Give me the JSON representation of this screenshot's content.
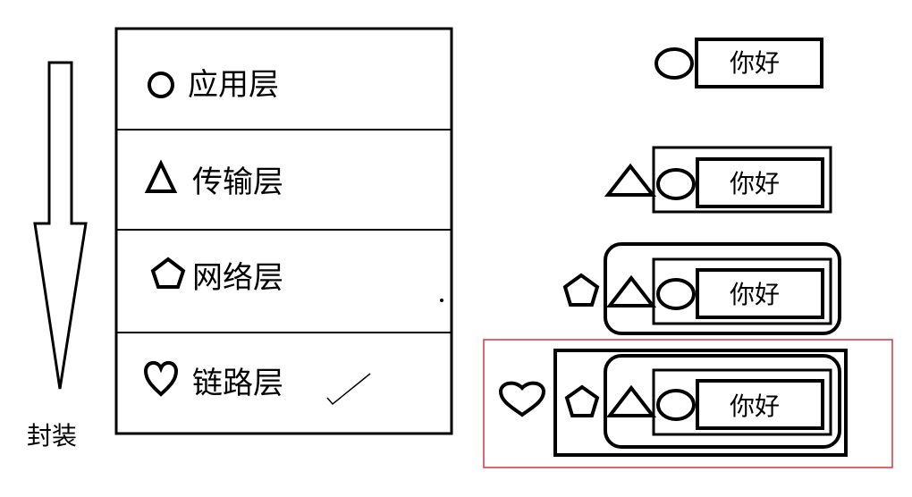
{
  "layers": [
    {
      "label": "应用层",
      "icon": "circle-icon"
    },
    {
      "label": "传输层",
      "icon": "triangle-icon"
    },
    {
      "label": "网络层",
      "icon": "pentagon-icon"
    },
    {
      "label": "链路层",
      "icon": "heart-icon"
    }
  ],
  "encapsulation_label": "封装",
  "payload_text": "你好",
  "colors": {
    "stroke": "#000000",
    "highlight": "#d6333f"
  }
}
